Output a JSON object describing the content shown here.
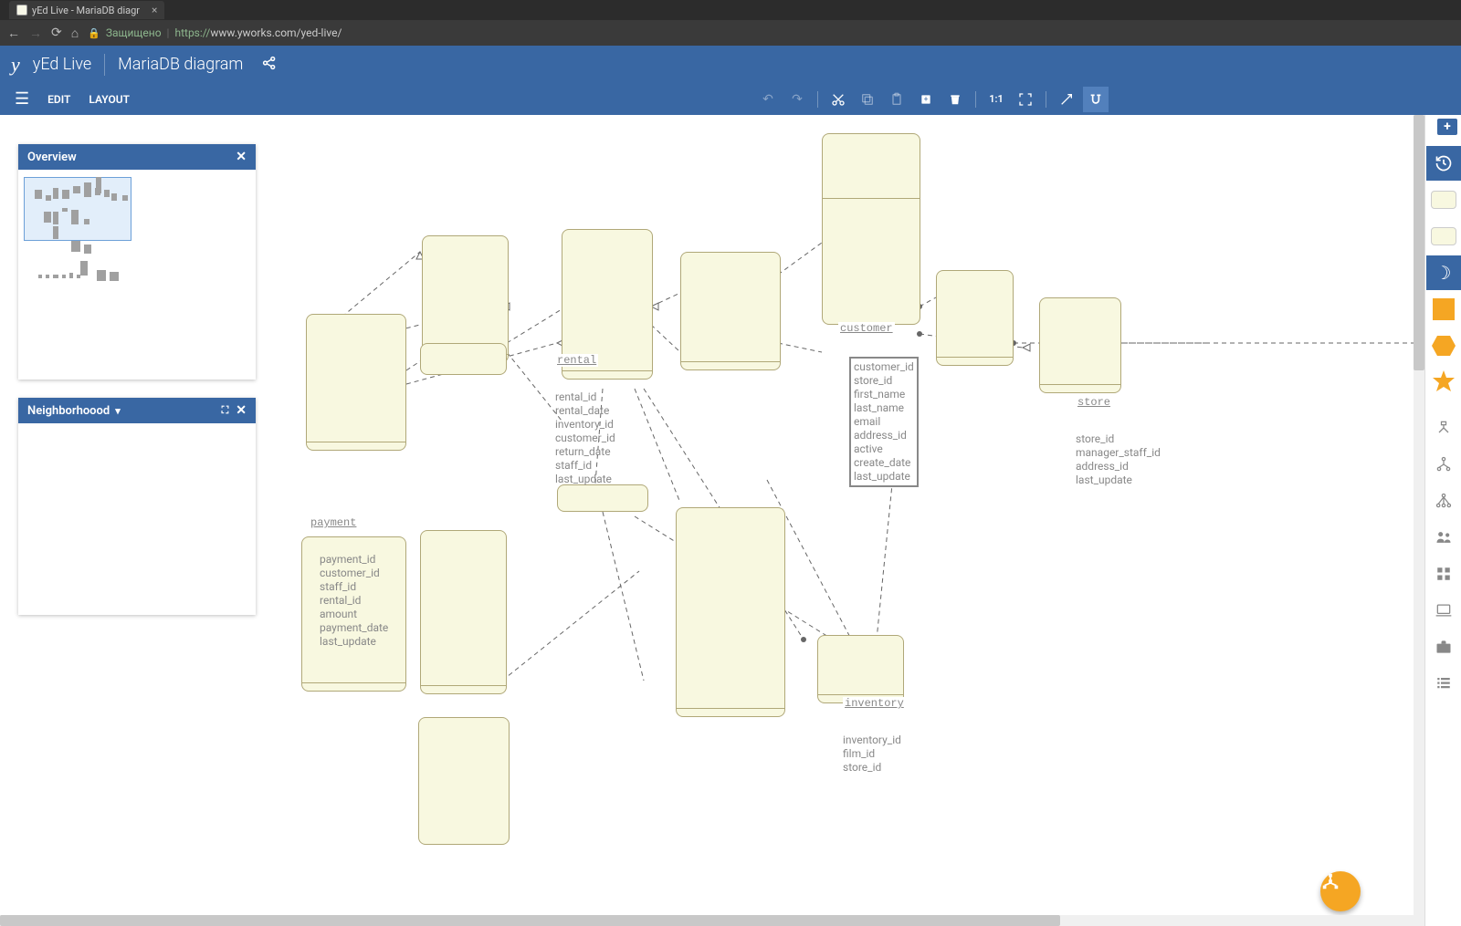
{
  "browser": {
    "tab_title": "yEd Live - MariaDB diagr",
    "secured": "Защищено",
    "url_proto": "https://",
    "url_rest": "www.yworks.com/yed-live/"
  },
  "header": {
    "logo": "y",
    "app": "yEd Live",
    "doc": "MariaDB diagram"
  },
  "menu": {
    "edit": "EDIT",
    "layout": "LAYOUT",
    "zoom11": "1:1"
  },
  "panels": {
    "overview": "Overview",
    "neighborhood": "Neighborhoood"
  },
  "entities": {
    "rental": {
      "title": "rental",
      "fields": [
        "rental_id",
        "rental_date",
        "inventory_id",
        "customer_id",
        "return_date",
        "staff_id",
        "last_update"
      ]
    },
    "customer": {
      "title": "customer",
      "fields": [
        "customer_id",
        "store_id",
        "first_name",
        "last_name",
        "email",
        "address_id",
        "active",
        "create_date",
        "last_update"
      ]
    },
    "store": {
      "title": "store",
      "fields": [
        "store_id",
        "manager_staff_id",
        "address_id",
        "last_update"
      ]
    },
    "payment": {
      "title": "payment",
      "fields": [
        "payment_id",
        "customer_id",
        "staff_id",
        "rental_id",
        "amount",
        "payment_date",
        "last_update"
      ]
    },
    "inventory": {
      "title": "inventory",
      "fields": [
        "inventory_id",
        "film_id",
        "store_id"
      ]
    }
  }
}
